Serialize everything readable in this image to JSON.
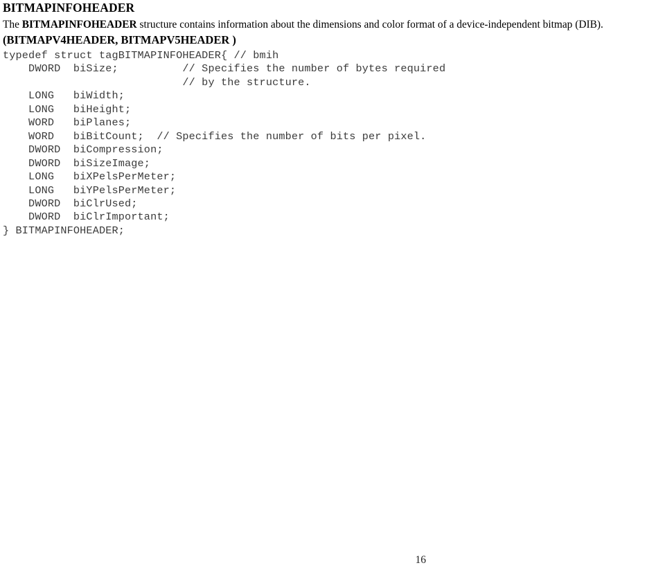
{
  "document": {
    "title": "BITMAPINFOHEADER",
    "description": {
      "prefix": "The ",
      "bold_term": "BITMAPINFOHEADER",
      "suffix": " structure contains information about the dimensions and color format of a device-independent bitmap (DIB).",
      "related_line": "(BITMAPV4HEADER, BITMAPV5HEADER )"
    },
    "code": {
      "language": "c",
      "lines": [
        "typedef struct tagBITMAPINFOHEADER{ // bmih",
        "    DWORD  biSize;          // Specifies the number of bytes required",
        "                            // by the structure.",
        "    LONG   biWidth;",
        "    LONG   biHeight;",
        "    WORD   biPlanes;",
        "    WORD   biBitCount;  // Specifies the number of bits per pixel.",
        "    DWORD  biCompression;",
        "    DWORD  biSizeImage;",
        "    LONG   biXPelsPerMeter;",
        "    LONG   biYPelsPerMeter;",
        "    DWORD  biClrUsed;",
        "    DWORD  biClrImportant;",
        "} BITMAPINFOHEADER;"
      ]
    },
    "footer": {
      "page_number": "16"
    }
  }
}
